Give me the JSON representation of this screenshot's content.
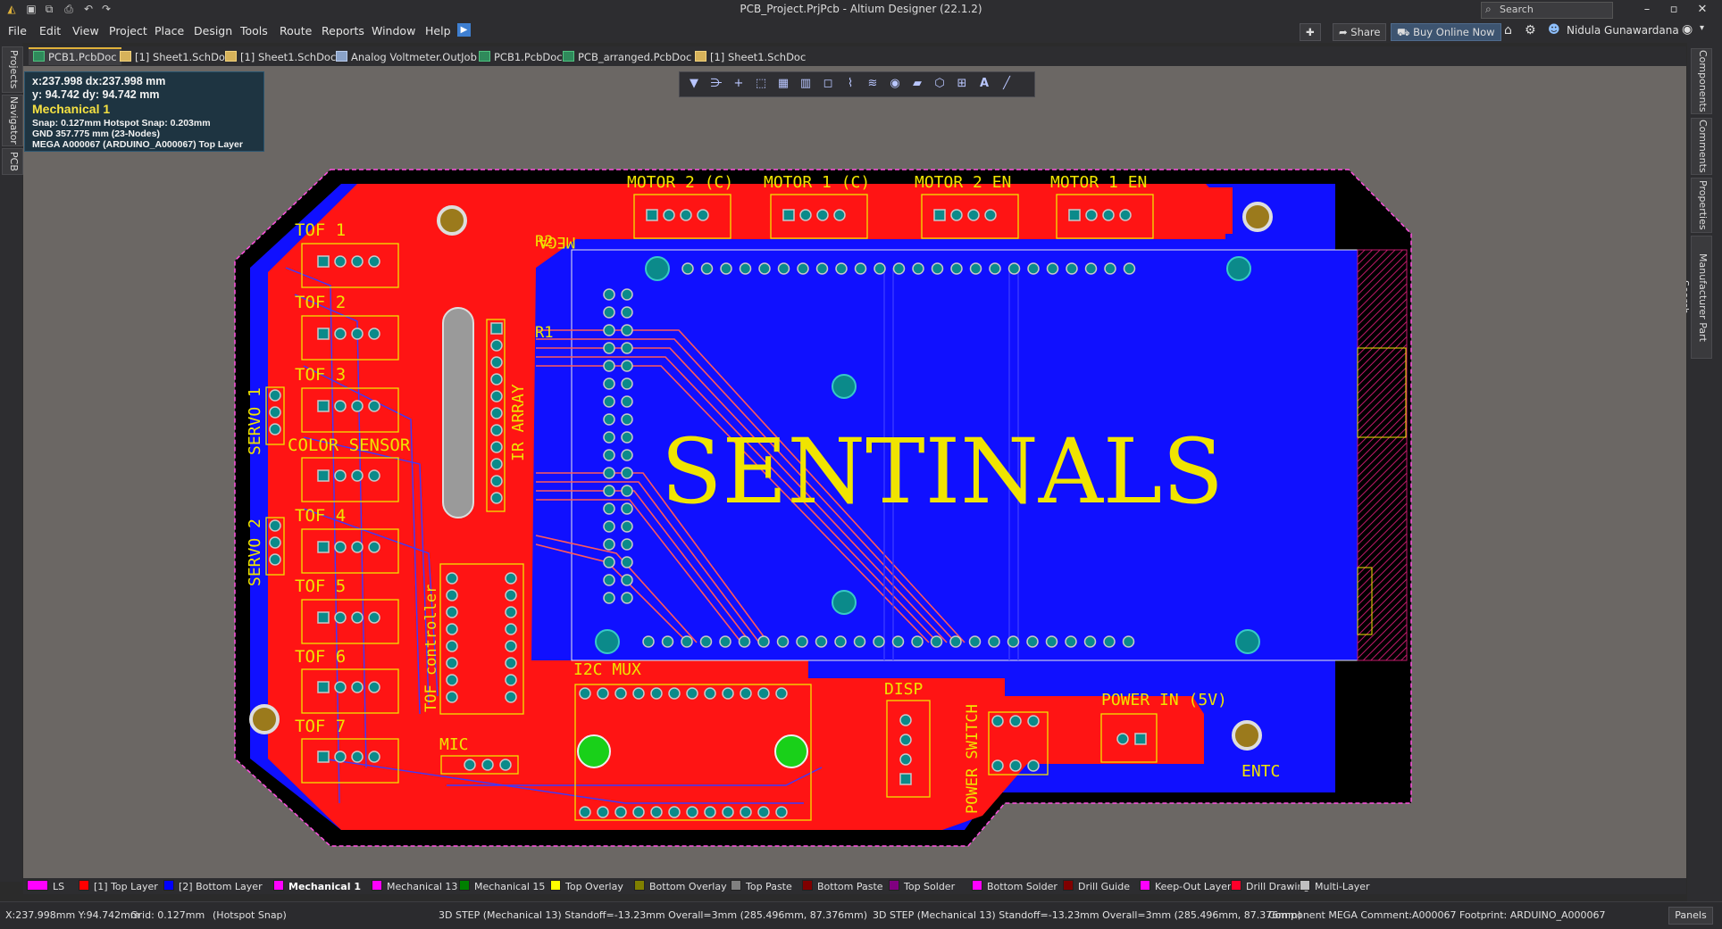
{
  "window": {
    "title": "PCB_Project.PrjPcb - Altium Designer (22.1.2)",
    "search_label": "Search"
  },
  "menu": [
    "File",
    "Edit",
    "View",
    "Project",
    "Place",
    "Design",
    "Tools",
    "Route",
    "Reports",
    "Window",
    "Help"
  ],
  "topright": {
    "share_label": "Share",
    "buy_label": "Buy Online Now",
    "user_name": "Nidula  Gunawardana"
  },
  "doc_tabs": [
    {
      "label": "PCB1.PcbDoc",
      "icon": "pcb-doc-icon",
      "active": true
    },
    {
      "label": "[1] Sheet1.SchDoc",
      "icon": "sch-doc-icon"
    },
    {
      "label": "[1] Sheet1.SchDoc",
      "icon": "sch-doc-icon"
    },
    {
      "label": "Analog Voltmeter.OutJob",
      "icon": "outjob-icon"
    },
    {
      "label": "PCB1.PcbDoc",
      "icon": "pcb-doc-icon"
    },
    {
      "label": "PCB_arranged.PcbDoc",
      "icon": "pcb-doc-icon"
    },
    {
      "label": "[1] Sheet1.SchDoc",
      "icon": "sch-doc-icon"
    }
  ],
  "left_panels": [
    "Projects",
    "Navigator",
    "PCB"
  ],
  "right_panels": [
    "Components",
    "Comments",
    "Properties",
    "Manufacturer Part Search"
  ],
  "hud": {
    "line1": "x:237.998   dx:237.998 mm",
    "line2": "y: 94.742    dy: 94.742  mm",
    "layer": "Mechanical 1",
    "snap": "Snap: 0.127mm Hotspot Snap: 0.203mm",
    "net": "GND  357.775 mm  (23-Nodes)",
    "component": "MEGA  A000067 (ARDUINO_A000067)  Top Layer"
  },
  "pcb_toolbar_icons": [
    "filter-icon",
    "route-icon",
    "cross-icon",
    "select-rect-icon",
    "component-icon",
    "chart-icon",
    "rectangle-icon",
    "interactive-route-icon",
    "diff-pair-icon",
    "via-icon",
    "region-icon",
    "polygon-icon",
    "dimension-icon",
    "string-icon",
    "line-icon"
  ],
  "board": {
    "title": "SENTINALS",
    "labels": [
      "TOF 1",
      "TOF 2",
      "TOF 3",
      "COLOR SENSOR",
      "TOF 4",
      "TOF 5",
      "TOF 6",
      "TOF 7",
      "SERVO 1",
      "SERVO 2",
      "R2",
      "R1",
      "MEGA",
      "IR ARRAY",
      "TOF controller",
      "MIC",
      "I2C MUX",
      "DISP",
      "POWER SWITCH",
      "POWER IN (5V)",
      "ENTC",
      "MOTOR 2 (C)",
      "MOTOR 1 (C)",
      "MOTOR 2 EN",
      "MOTOR 1 EN"
    ]
  },
  "layers": [
    {
      "label": "LS",
      "color": "#ff00ff"
    },
    {
      "label": "[1] Top Layer",
      "color": "#ff0000"
    },
    {
      "label": "[2] Bottom Layer",
      "color": "#0000ff"
    },
    {
      "label": "Mechanical 1",
      "color": "#ff00ff",
      "active": true
    },
    {
      "label": "Mechanical 13",
      "color": "#ff00ff"
    },
    {
      "label": "Mechanical 15",
      "color": "#008000"
    },
    {
      "label": "Top Overlay",
      "color": "#ffff00"
    },
    {
      "label": "Bottom Overlay",
      "color": "#808000"
    },
    {
      "label": "Top Paste",
      "color": "#808080"
    },
    {
      "label": "Bottom Paste",
      "color": "#800000"
    },
    {
      "label": "Top Solder",
      "color": "#800080"
    },
    {
      "label": "Bottom Solder",
      "color": "#ff00ff"
    },
    {
      "label": "Drill Guide",
      "color": "#800000"
    },
    {
      "label": "Keep-Out Layer",
      "color": "#ff00ff"
    },
    {
      "label": "Drill Drawing",
      "color": "#ff002a"
    },
    {
      "label": "Multi-Layer",
      "color": "#c0c0c0"
    }
  ],
  "status": {
    "coords": "X:237.998mm Y:94.742mm",
    "grid": "Grid: 0.127mm",
    "snap": "(Hotspot Snap)",
    "step1": "3D STEP  (Mechanical 13)  Standoff=-13.23mm  Overall=3mm  (285.496mm, 87.376mm)",
    "step2": "3D STEP  (Mechanical 13)  Standoff=-13.23mm  Overall=3mm  (285.496mm, 87.376mm)",
    "component": "Component MEGA Comment:A000067 Footprint: ARDUINO_A000067",
    "panels_label": "Panels"
  }
}
